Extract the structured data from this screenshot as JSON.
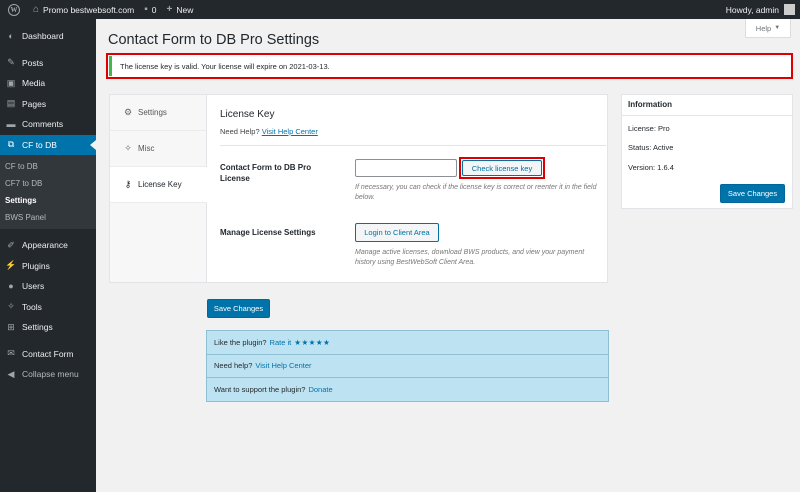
{
  "adminbar": {
    "site_name": "Promo bestwebsoft.com",
    "comments_count": "0",
    "new_label": "New",
    "howdy": "Howdy, admin"
  },
  "sidebar": {
    "items": [
      {
        "label": "Dashboard",
        "icon": "dashboard-icon"
      },
      {
        "label": "Posts",
        "icon": "pin-icon"
      },
      {
        "label": "Media",
        "icon": "media-icon"
      },
      {
        "label": "Pages",
        "icon": "pages-icon"
      },
      {
        "label": "Comments",
        "icon": "comments-icon"
      },
      {
        "label": "CF to DB",
        "icon": "cf-to-db-icon"
      },
      {
        "label": "Appearance",
        "icon": "brush-icon"
      },
      {
        "label": "Plugins",
        "icon": "plugin-icon"
      },
      {
        "label": "Users",
        "icon": "users-icon"
      },
      {
        "label": "Tools",
        "icon": "wrench-icon"
      },
      {
        "label": "Settings",
        "icon": "settings-icon"
      },
      {
        "label": "Contact Form",
        "icon": "mail-icon"
      },
      {
        "label": "Collapse menu",
        "icon": "collapse-icon"
      }
    ],
    "submenu": [
      "CF to DB",
      "CF7 to DB",
      "Settings",
      "BWS Panel"
    ]
  },
  "help_tab": "Help",
  "page_title": "Contact Form to DB Pro Settings",
  "notice": "The license key is valid. Your license will expire on 2021-03-13.",
  "tabs": [
    {
      "label": "Settings",
      "icon": "gear-icon"
    },
    {
      "label": "Misc",
      "icon": "wrench-icon"
    },
    {
      "label": "License Key",
      "icon": "key-icon"
    }
  ],
  "license": {
    "title": "License Key",
    "need_help": "Need Help?",
    "visit_help_center": "Visit Help Center",
    "field_label": "Contact Form to DB Pro License",
    "input_value": "",
    "check_button": "Check license key",
    "field_desc": "If necessary, you can check if the license key is correct or reenter it in the field below.",
    "manage_label": "Manage License Settings",
    "login_button": "Login to Client Area",
    "manage_desc": "Manage active licenses, download BWS products, and view your payment history using BestWebSoft Client Area."
  },
  "save_button": "Save Changes",
  "info": {
    "title": "Information",
    "license": "License: Pro",
    "status": "Status: Active",
    "version": "Version: 1.6.4",
    "save_button": "Save Changes"
  },
  "support": {
    "like_text": "Like the plugin?",
    "rate_link": "Rate it",
    "stars": "★★★★★",
    "need_help_text": "Need help?",
    "help_link": "Visit Help Center",
    "support_text": "Want to support the plugin?",
    "donate_link": "Donate"
  },
  "colors": {
    "accent": "#0073aa",
    "sidebar_bg": "#23282d",
    "notice_success": "#46b450",
    "highlight_red": "#dd0000"
  }
}
